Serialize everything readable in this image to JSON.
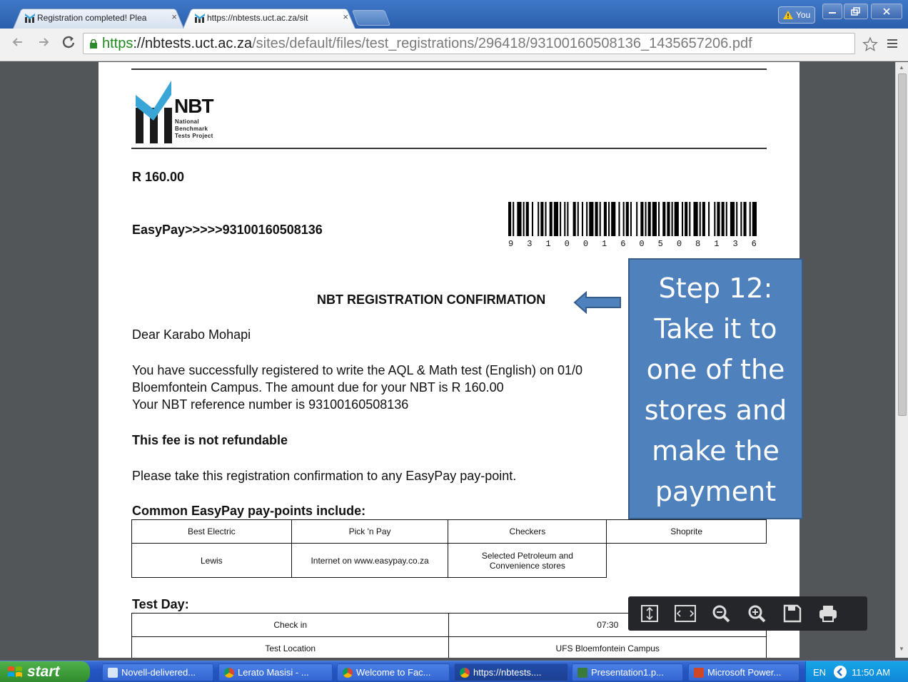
{
  "browser": {
    "tabs": [
      {
        "label": "Registration completed! Plea",
        "active": false
      },
      {
        "label": "https://nbtests.uct.ac.za/sit",
        "active": true
      }
    ],
    "user_label": "You",
    "close_glyph": "×",
    "url": {
      "scheme": "https",
      "host": "://nbtests.uct.ac.za",
      "path": "/sites/default/files/test_registrations/296418/93100160508136_1435657206.pdf"
    }
  },
  "document": {
    "logo_title": "NBT",
    "logo_line1": "National",
    "logo_line2": "Benchmark",
    "logo_line3": "Tests Project",
    "amount": "R 160.00",
    "easypay": "EasyPay>>>>>93100160508136",
    "barcode_digits": [
      "9",
      "3",
      "1",
      "0",
      "0",
      "1",
      "6",
      "0",
      "5",
      "0",
      "8",
      "1",
      "3",
      "6"
    ],
    "title": "NBT REGISTRATION CONFIRMATION",
    "greeting": "Dear Karabo Mohapi",
    "para1_line1": "You have successfully registered to write the AQL & Math test (English) on 01/0",
    "para1_line2": "Bloemfontein Campus. The amount due for your NBT is R 160.00",
    "para1_line3": "Your NBT reference number is 93100160508136",
    "fee_note": "This fee is not refundable",
    "instruction": "Please take this registration confirmation to any EasyPay pay-point.",
    "paypoints_heading": "Common EasyPay pay-points include:",
    "paypoints": [
      [
        "Best Electric",
        "Pick 'n Pay",
        "Checkers",
        "Shoprite"
      ],
      [
        "Lewis",
        "Internet on www.easypay.co.za",
        "Selected Petroleum and Convenience stores",
        ""
      ]
    ],
    "testday_heading": "Test Day:",
    "testday": [
      [
        "Check in",
        "07:30"
      ],
      [
        "Test Location",
        "UFS Bloemfontein Campus"
      ]
    ]
  },
  "callout": {
    "lines": [
      "Step 12:",
      "Take it to",
      "one of the",
      "stores and",
      "make the",
      "payment"
    ],
    "fill_color": "#4f81bd"
  },
  "pdf_toolbar": [
    "fit-page-icon",
    "fit-width-icon",
    "zoom-out-icon",
    "zoom-in-icon",
    "save-icon",
    "print-icon"
  ],
  "taskbar": {
    "start_label": "start",
    "tasks": [
      {
        "label": "Novell-delivered...",
        "active": false
      },
      {
        "label": "Lerato Masisi - ...",
        "active": false
      },
      {
        "label": "Welcome to Fac...",
        "active": false
      },
      {
        "label": "https://nbtests....",
        "active": true
      },
      {
        "label": "Presentation1.p...",
        "active": false
      },
      {
        "label": "Microsoft Power...",
        "active": false
      }
    ],
    "language": "EN",
    "clock": "11:50 AM"
  }
}
